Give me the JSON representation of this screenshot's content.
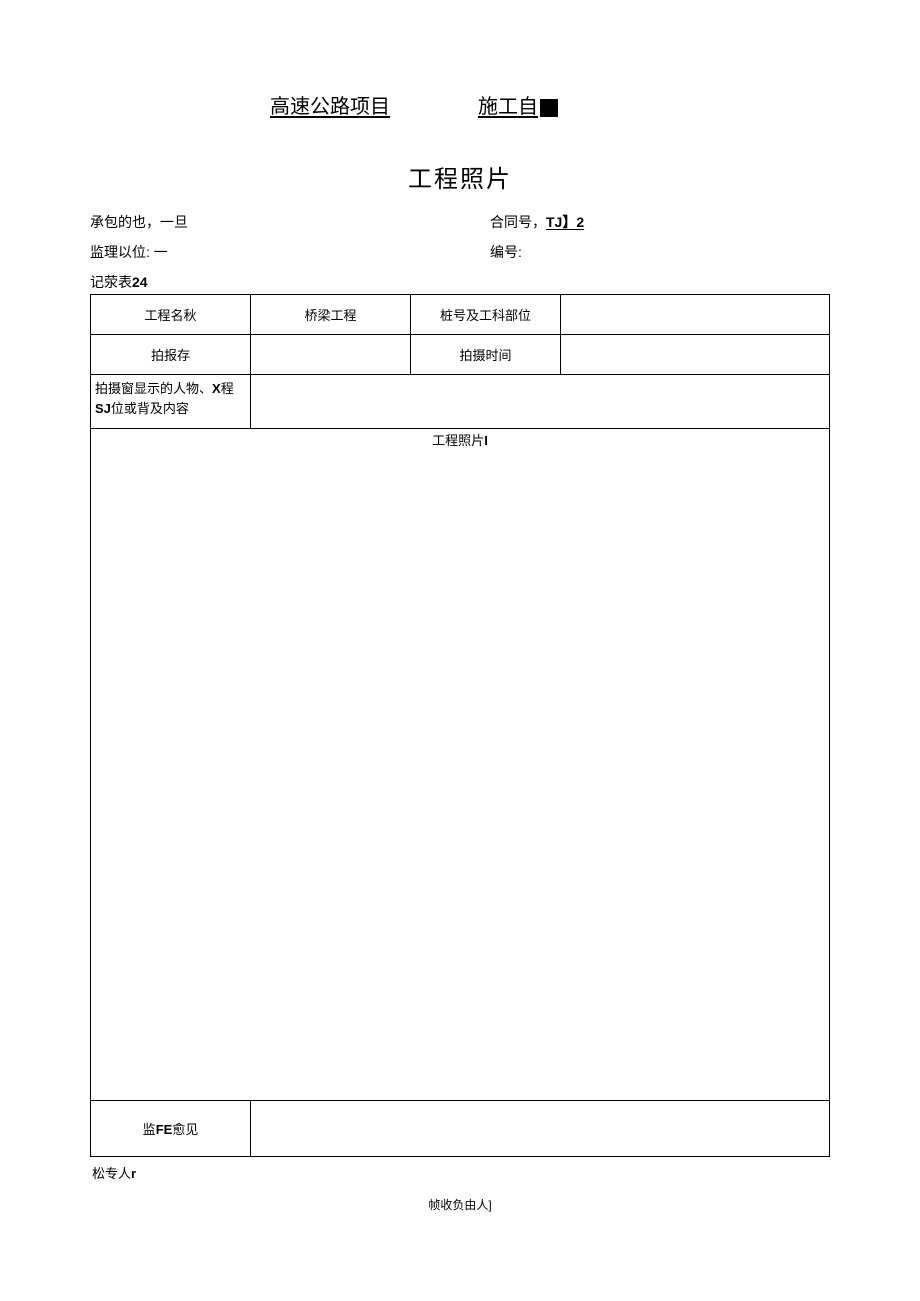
{
  "header": {
    "left": "高速公路项目",
    "right_prefix": "施工自"
  },
  "title": "工程照片",
  "info": {
    "contractor_label": "承包的也，一旦",
    "contract_label_prefix": "合同号，",
    "contract_value": "TJ】2",
    "supervisor_label": "监理以位:  一",
    "serial_label": "编号:"
  },
  "record_label": "记荥表",
  "record_num": "24",
  "table": {
    "row1": {
      "c1": "工程名秋",
      "c2": "桥梁工程",
      "c3": "桩号及工科部位",
      "c4": ""
    },
    "row2": {
      "c1": "拍报存",
      "c2": "",
      "c3": "拍摄时间",
      "c4": ""
    },
    "row3": {
      "c1_line1": "拍摄窗显示的人物、",
      "c1_line1_bold": "X",
      "c1_line1_end": "程",
      "c1_line2_bold": "SJ",
      "c1_line2_rest": "位或背及内容",
      "c2": ""
    },
    "photo_label": "工程照片",
    "photo_label_suffix": "I",
    "opinion_label_prefix": "监",
    "opinion_label_bold": "FE",
    "opinion_label_suffix": "愈见"
  },
  "footer": {
    "line1_prefix": "松专人",
    "line1_bold": "r",
    "line2": "帧收负由人]"
  }
}
